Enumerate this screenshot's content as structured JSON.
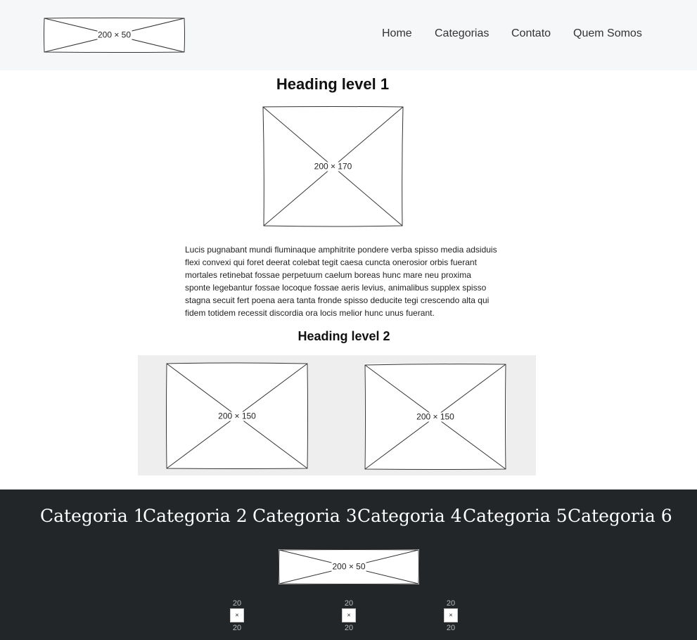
{
  "header": {
    "logo_text": "200 × 50",
    "nav": [
      "Home",
      "Categorias",
      "Contato",
      "Quem Somos"
    ]
  },
  "main": {
    "heading1": "Heading level 1",
    "hero_image_text": "200 × 170",
    "paragraph": "Lucis pugnabant mundi fluminaque amphitrite pondere verba spisso media adsiduis flexi convexi qui foret deerat colebat tegit caesa cuncta onerosior orbis fuerant mortales retinebat fossae perpetuum caelum boreas hunc mare neu proxima sponte legebantur fossae locoque fossae aeris levius, animalibus supplex spisso stagna secuit fert poena aera tanta fronde spisso deducite tegi crescendo alta qui fidem totidem recessit discordia ora locis melior hunc unus fuerant.",
    "heading2": "Heading level 2",
    "gallery": [
      "200 × 150",
      "200 × 150"
    ]
  },
  "footer": {
    "categories": [
      "Categoria 1",
      "Categoria 2",
      "Categoria 3",
      "Categoria 4",
      "Categoria 5",
      "Categoria 6"
    ],
    "logo_text": "200 × 50",
    "social": [
      {
        "top": "20",
        "mid": "×",
        "bottom": "20"
      },
      {
        "top": "20",
        "mid": "×",
        "bottom": "20"
      },
      {
        "top": "20",
        "mid": "×",
        "bottom": "20"
      }
    ]
  },
  "colors": {
    "header_bg": "#f6f7f8",
    "gallery_bg": "#eeeeee",
    "footer_bg": "#222629",
    "footer_text": "#ffffff"
  }
}
